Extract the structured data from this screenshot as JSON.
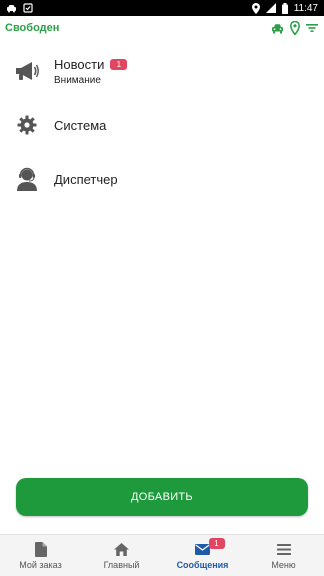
{
  "statusbar": {
    "time": "11:47",
    "icons": [
      "car-small-icon",
      "notification-icon",
      "location-icon",
      "signal-icon",
      "battery-icon"
    ]
  },
  "header": {
    "status": "Свободен",
    "actions": [
      "taxi-icon",
      "map-pin-icon",
      "filter-icon"
    ],
    "accent": "#2e9e4a"
  },
  "list": {
    "items": [
      {
        "title": "Новости",
        "subtitle": "Внимание",
        "badge": "1",
        "icon": "megaphone-icon"
      },
      {
        "title": "Система",
        "icon": "gear-icon"
      },
      {
        "title": "Диспетчер",
        "icon": "operator-icon"
      }
    ]
  },
  "add_button": {
    "label": "ДОБАВИТЬ",
    "color": "#1e9a3c"
  },
  "bottomnav": {
    "items": [
      {
        "label": "Мой заказ",
        "icon": "document-icon"
      },
      {
        "label": "Главный",
        "icon": "home-icon"
      },
      {
        "label": "Сообщения",
        "icon": "mail-icon",
        "badge": "1",
        "active": true
      },
      {
        "label": "Меню",
        "icon": "menu-icon"
      }
    ],
    "active_color": "#1f5aa8",
    "badge_color": "#e0465f"
  }
}
